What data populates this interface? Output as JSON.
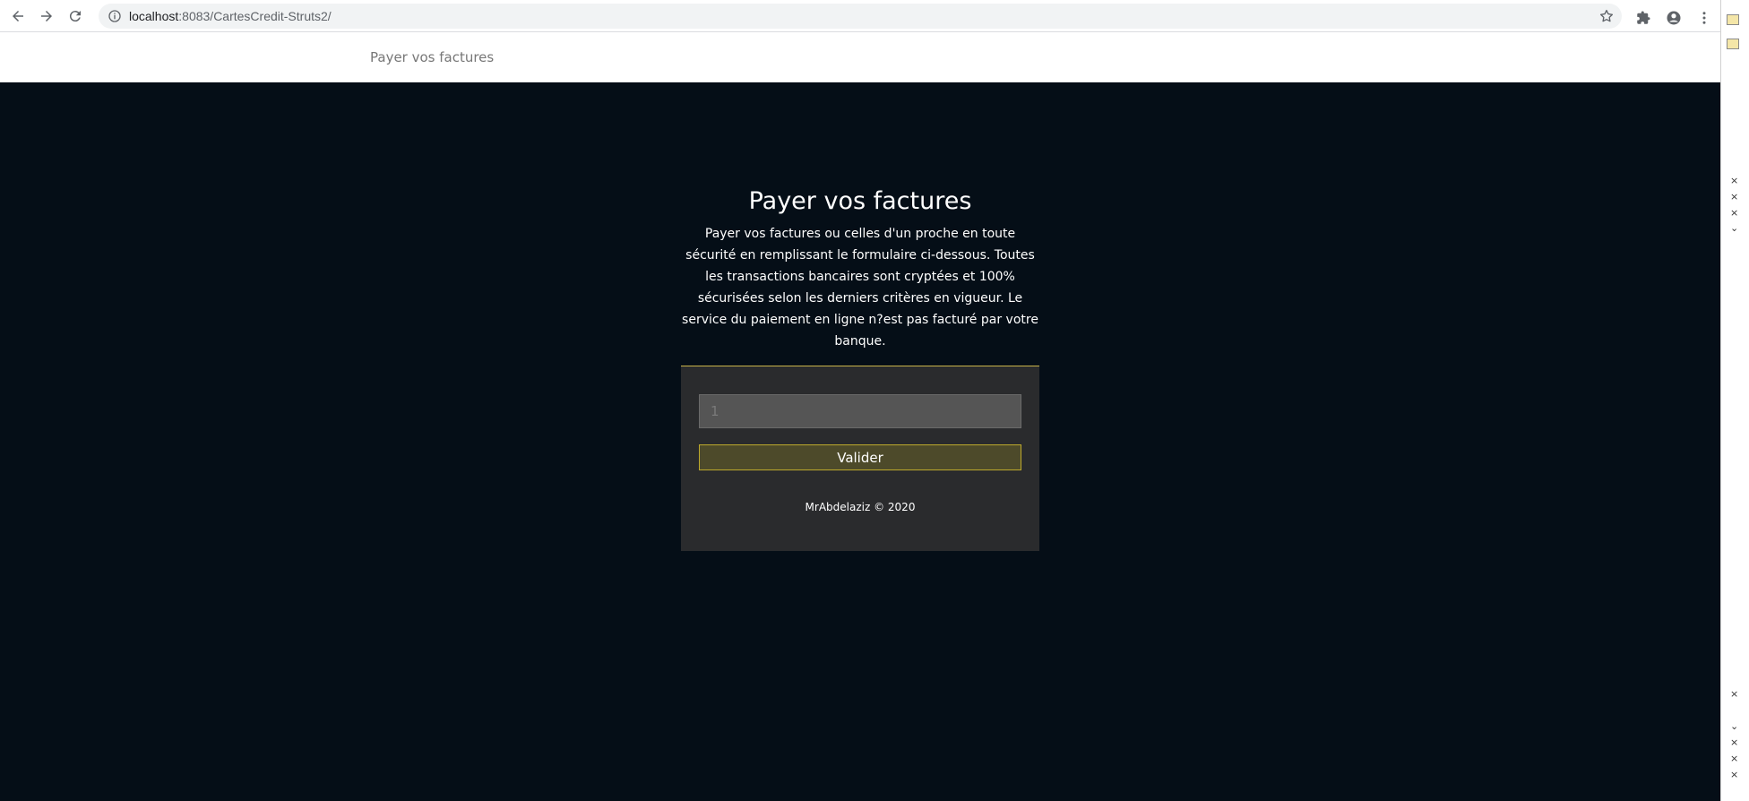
{
  "browser": {
    "url_host": "localhost",
    "url_path": ":8083/CartesCredit-Struts2/"
  },
  "header": {
    "brand": "Payer vos factures"
  },
  "intro": {
    "title": "Payer vos factures",
    "description": "Payer vos factures ou celles d'un proche en toute sécurité en remplissant le formulaire ci-dessous. Toutes les transactions bancaires sont cryptées et 100% sécurisées selon les derniers critères en vigueur. Le service du paiement en ligne n?est pas facturé par votre banque."
  },
  "form": {
    "input_placeholder": "1",
    "submit_label": "Valider"
  },
  "footer": {
    "credit": "MrAbdelaziz © 2020"
  },
  "icons": {
    "back": "arrow-left-icon",
    "forward": "arrow-right-icon",
    "reload": "reload-icon",
    "info": "info-icon",
    "bookmark": "star-icon",
    "extensions": "puzzle-icon",
    "profile": "account-icon",
    "menu": "kebab-menu-icon"
  },
  "colors": {
    "page_background": "#050e17",
    "panel_background": "#2a2b2d",
    "accent_border": "#bda92c",
    "button_background": "#4d4a2a"
  }
}
